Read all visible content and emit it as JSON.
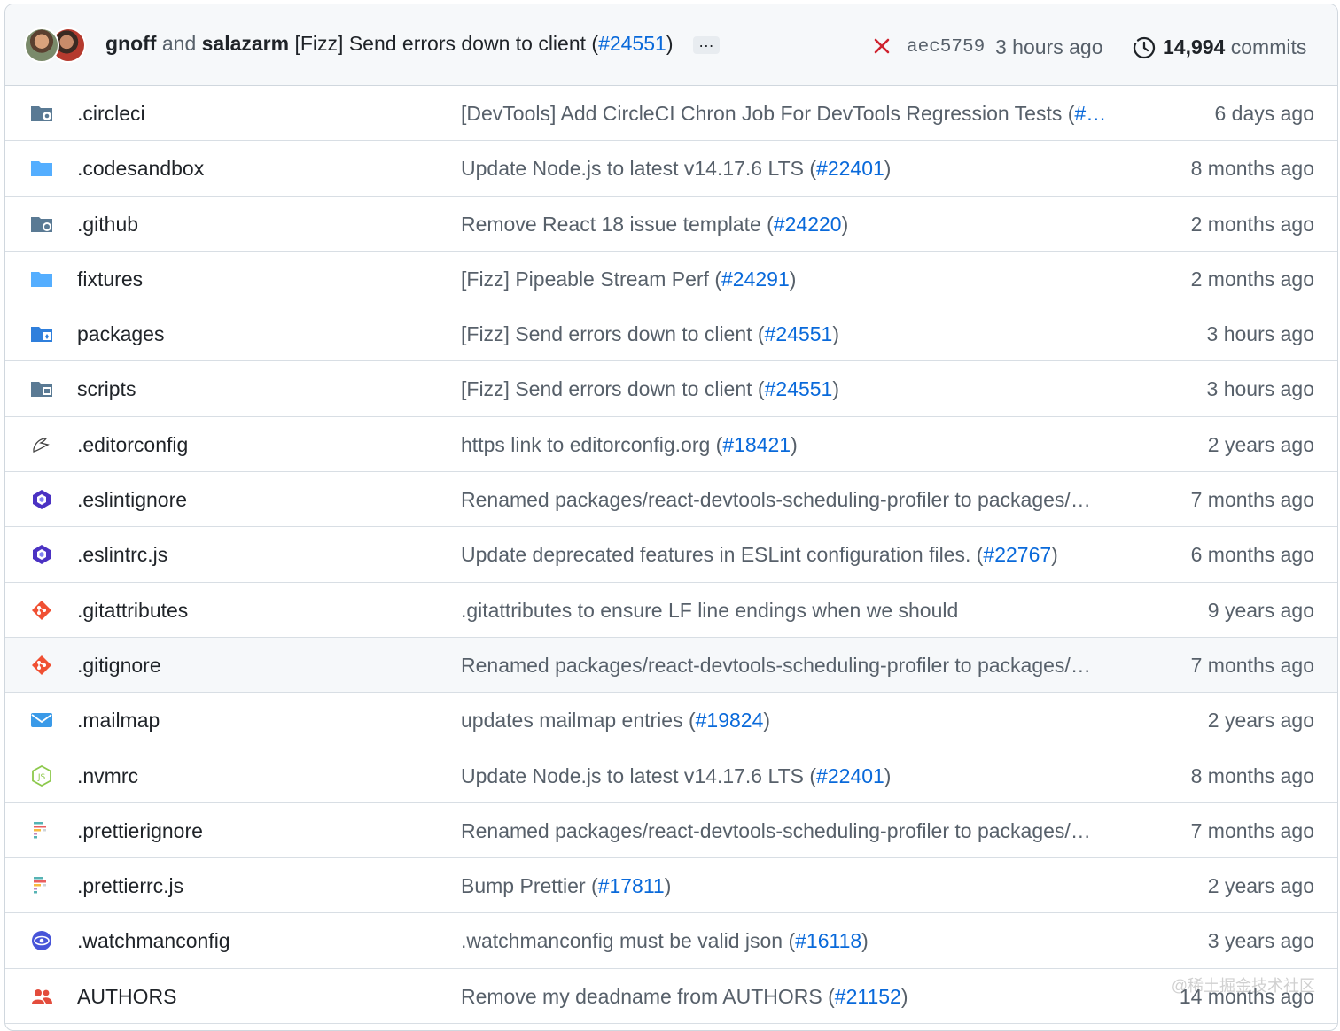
{
  "header": {
    "author1": "gnoff",
    "conj": "and",
    "author2": "salazarm",
    "commit_prefix": "[Fizz] Send errors down to client (",
    "commit_pr": "#24551",
    "commit_suffix": ")",
    "ellipsis": "…",
    "sha": "aec5759",
    "time": "3 hours ago",
    "commit_count": "14,994",
    "commit_word": "commits",
    "colors": {
      "status_fail": "#cf222e",
      "link": "#0969da",
      "folder": "#54aeff"
    }
  },
  "rows": [
    {
      "name": ".circleci",
      "icon": "folder-circleci-icon",
      "msg_before": "[DevTools] Add CircleCI Chron Job For DevTools Regression Tests (",
      "pr": "#…",
      "msg_after": "",
      "age": "6 days ago"
    },
    {
      "name": ".codesandbox",
      "icon": "folder-icon",
      "msg_before": "Update Node.js to latest v14.17.6 LTS (",
      "pr": "#22401",
      "msg_after": ")",
      "age": "8 months ago"
    },
    {
      "name": ".github",
      "icon": "folder-github-icon",
      "msg_before": "Remove React 18 issue template (",
      "pr": "#24220",
      "msg_after": ")",
      "age": "2 months ago"
    },
    {
      "name": "fixtures",
      "icon": "folder-icon",
      "msg_before": "[Fizz] Pipeable Stream Perf (",
      "pr": "#24291",
      "msg_after": ")",
      "age": "2 months ago"
    },
    {
      "name": "packages",
      "icon": "folder-packages-icon",
      "msg_before": "[Fizz] Send errors down to client (",
      "pr": "#24551",
      "msg_after": ")",
      "age": "3 hours ago"
    },
    {
      "name": "scripts",
      "icon": "folder-scripts-icon",
      "msg_before": "[Fizz] Send errors down to client (",
      "pr": "#24551",
      "msg_after": ")",
      "age": "3 hours ago"
    },
    {
      "name": ".editorconfig",
      "icon": "editorconfig-icon",
      "msg_before": "https link to editorconfig.org (",
      "pr": "#18421",
      "msg_after": ")",
      "age": "2 years ago"
    },
    {
      "name": ".eslintignore",
      "icon": "eslint-icon",
      "msg_before": "Renamed packages/react-devtools-scheduling-profiler to packages/…",
      "pr": "",
      "msg_after": "",
      "age": "7 months ago"
    },
    {
      "name": ".eslintrc.js",
      "icon": "eslint-icon",
      "msg_before": "Update deprecated features in ESLint configuration files. (",
      "pr": "#22767",
      "msg_after": ")",
      "age": "6 months ago"
    },
    {
      "name": ".gitattributes",
      "icon": "git-icon",
      "msg_before": ".gitattributes to ensure LF line endings when we should",
      "pr": "",
      "msg_after": "",
      "age": "9 years ago"
    },
    {
      "name": ".gitignore",
      "icon": "git-icon",
      "msg_before": "Renamed packages/react-devtools-scheduling-profiler to packages/…",
      "pr": "",
      "msg_after": "",
      "age": "7 months ago",
      "hover": true
    },
    {
      "name": ".mailmap",
      "icon": "mail-icon",
      "msg_before": "updates mailmap entries (",
      "pr": "#19824",
      "msg_after": ")",
      "age": "2 years ago"
    },
    {
      "name": ".nvmrc",
      "icon": "nodejs-icon",
      "msg_before": "Update Node.js to latest v14.17.6 LTS (",
      "pr": "#22401",
      "msg_after": ")",
      "age": "8 months ago"
    },
    {
      "name": ".prettierignore",
      "icon": "prettier-icon",
      "msg_before": "Renamed packages/react-devtools-scheduling-profiler to packages/…",
      "pr": "",
      "msg_after": "",
      "age": "7 months ago"
    },
    {
      "name": ".prettierrc.js",
      "icon": "prettier-icon",
      "msg_before": "Bump Prettier (",
      "pr": "#17811",
      "msg_after": ")",
      "age": "2 years ago"
    },
    {
      "name": ".watchmanconfig",
      "icon": "watchman-icon",
      "msg_before": ".watchmanconfig must be valid json (",
      "pr": "#16118",
      "msg_after": ")",
      "age": "3 years ago"
    },
    {
      "name": "AUTHORS",
      "icon": "people-icon",
      "msg_before": "Remove my deadname from AUTHORS (",
      "pr": "#21152",
      "msg_after": ")",
      "age": "14 months ago"
    }
  ],
  "watermark": "@稀土掘金技术社区"
}
